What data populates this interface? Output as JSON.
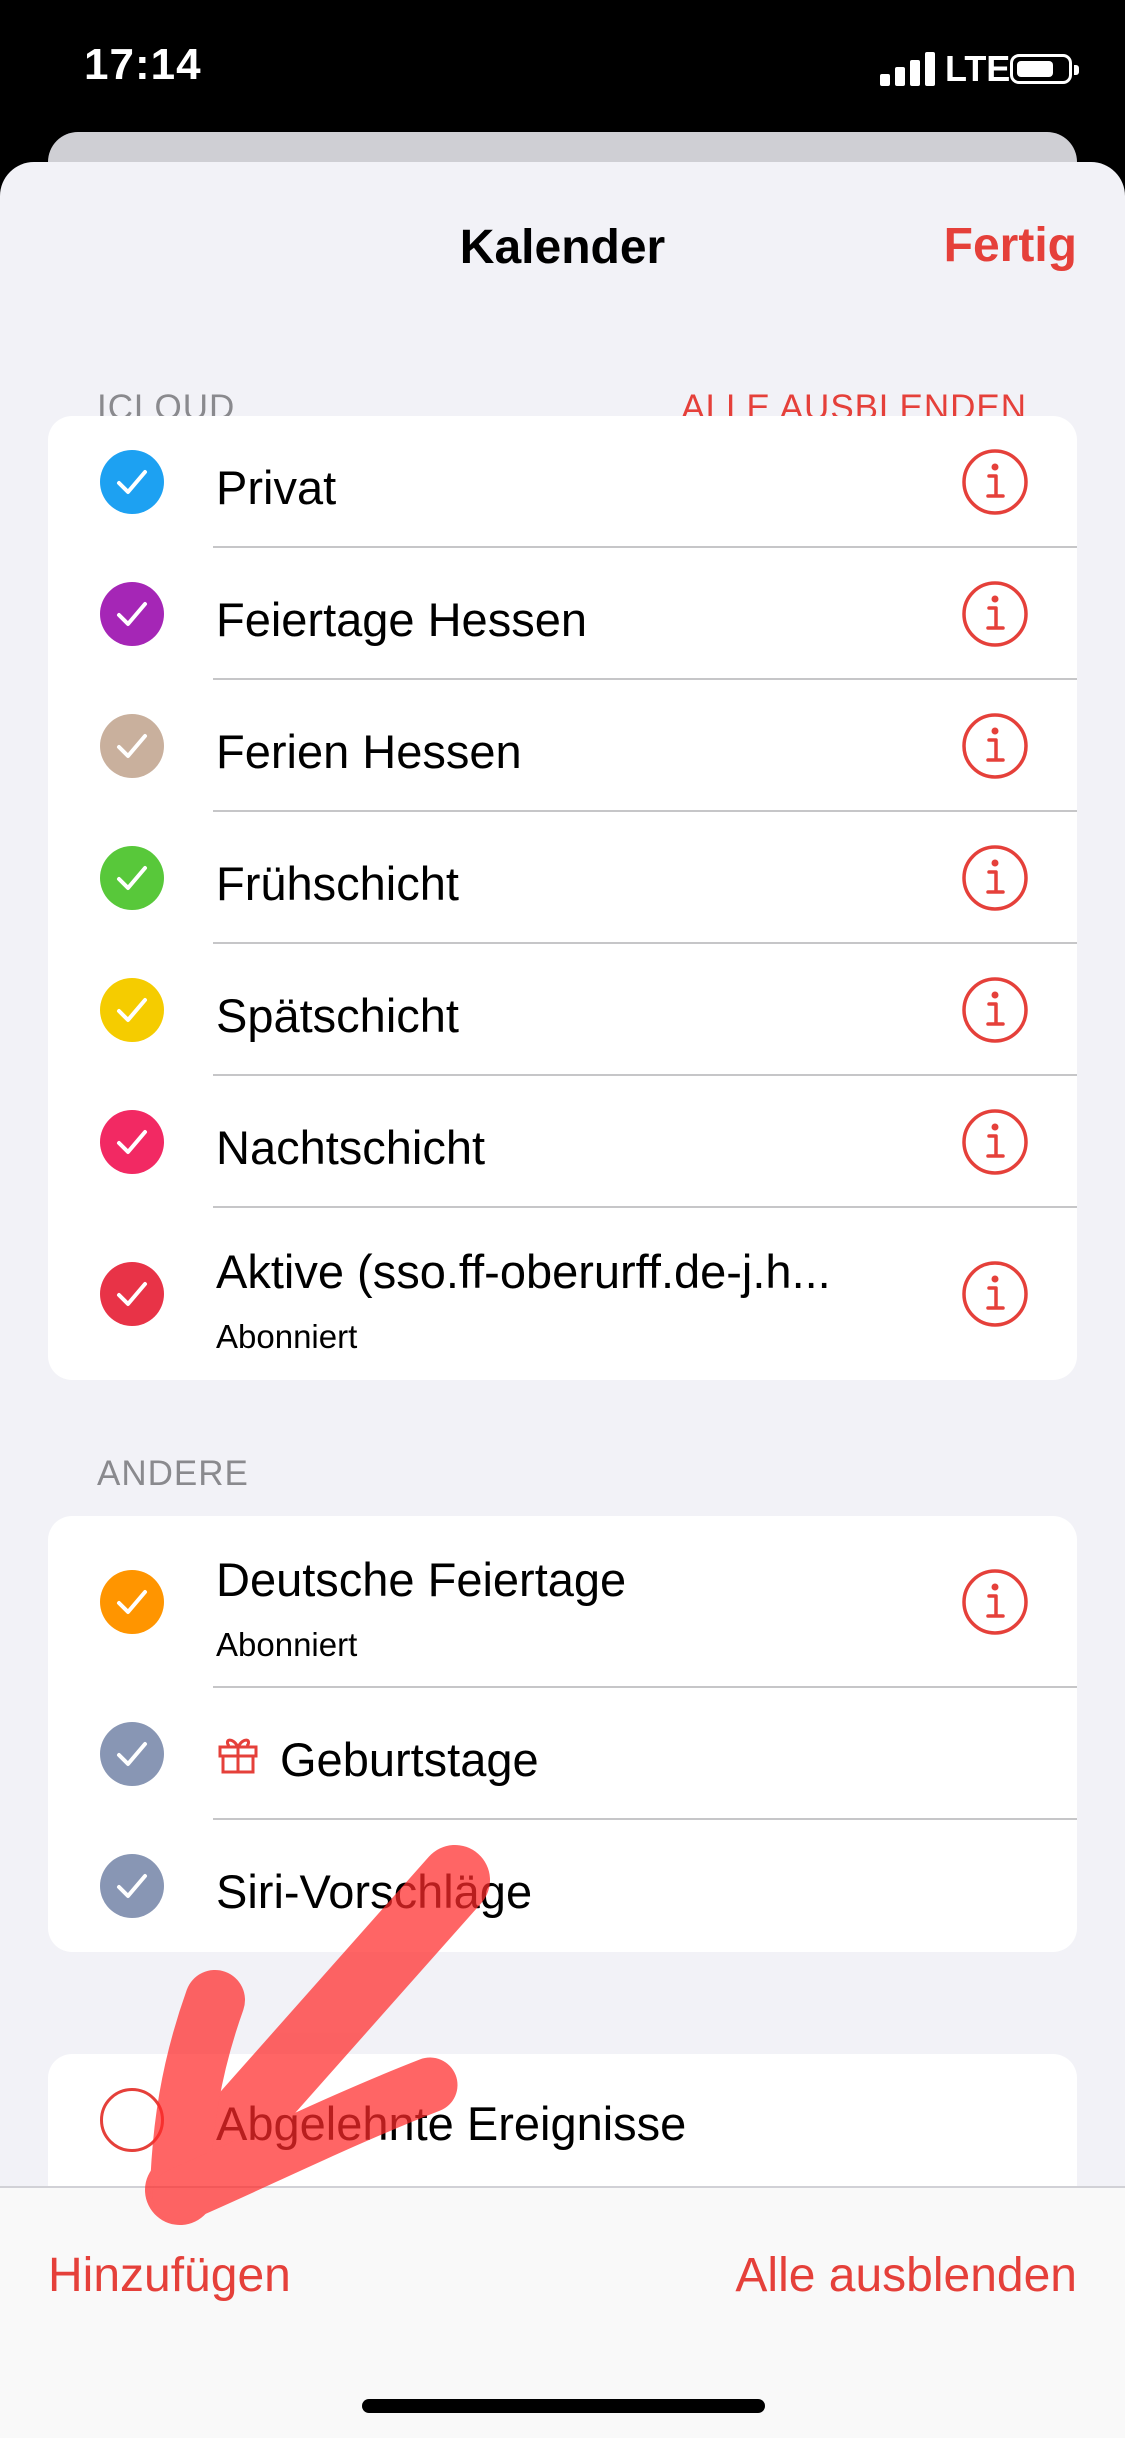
{
  "status_bar": {
    "time": "17:14",
    "carrier": "LTE"
  },
  "nav": {
    "title": "Kalender",
    "done": "Fertig"
  },
  "icloud": {
    "header": "ICLOUD",
    "action": "ALLE AUSBLENDEN",
    "items": [
      {
        "label": "Privat",
        "color": "#1da1f2",
        "checked": true
      },
      {
        "label": "Feiertage Hessen",
        "color": "#a526b6",
        "checked": true
      },
      {
        "label": "Ferien Hessen",
        "color": "#c9b09d",
        "checked": true
      },
      {
        "label": "Frühschicht",
        "color": "#58c83a",
        "checked": true
      },
      {
        "label": "Spätschicht",
        "color": "#f5cc00",
        "checked": true
      },
      {
        "label": "Nachtschicht",
        "color": "#f22963",
        "checked": true
      },
      {
        "label": "Aktive (sso.ff-oberurff.de-j.h...",
        "sublabel": "Abonniert",
        "color": "#e83347",
        "checked": true
      }
    ]
  },
  "andere": {
    "header": "ANDERE",
    "items": [
      {
        "label": "Deutsche Feiertage",
        "sublabel": "Abonniert",
        "color": "#ff9500",
        "checked": true
      },
      {
        "label": "Geburtstage",
        "color": "#8896b4",
        "checked": true,
        "icon": "gift-icon"
      },
      {
        "label": "Siri-Vorschläge",
        "color": "#8896b4",
        "checked": true
      }
    ]
  },
  "declined": {
    "label": "Abgelehnte Ereignisse",
    "checked": false
  },
  "toolbar": {
    "add": "Hinzufügen",
    "hide_all": "Alle ausblenden"
  },
  "accent_color": "#e5403a"
}
